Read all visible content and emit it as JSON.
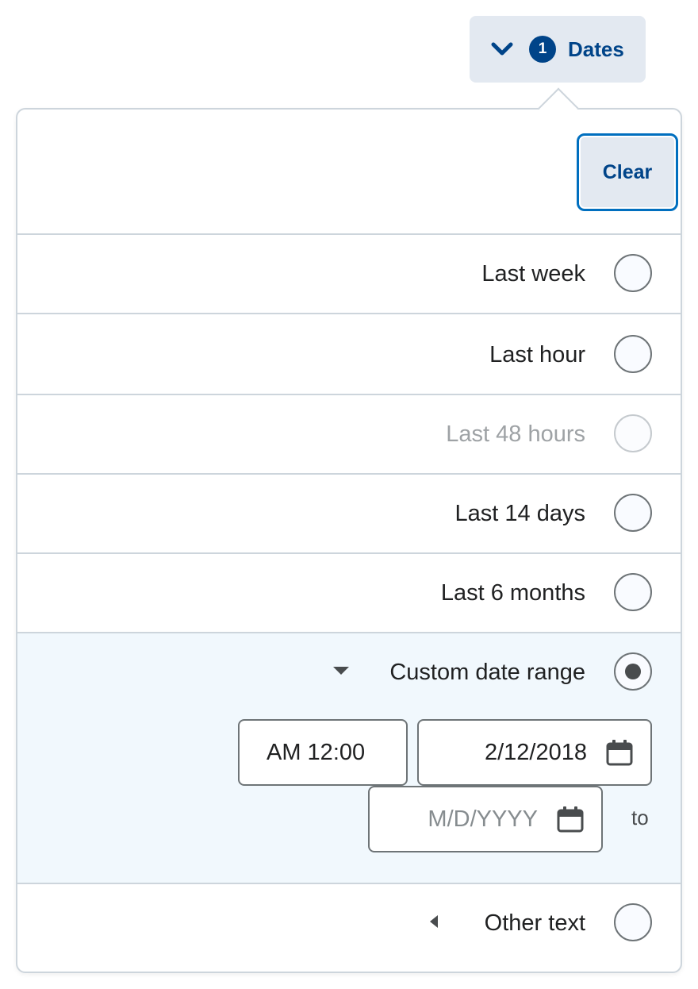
{
  "filter_button": {
    "count": "1",
    "label": "Dates"
  },
  "clear_label": "Clear",
  "options": [
    {
      "label": "Last week",
      "selected": false,
      "disabled": false
    },
    {
      "label": "Last hour",
      "selected": false,
      "disabled": false
    },
    {
      "label": "Last 48 hours",
      "selected": false,
      "disabled": true
    },
    {
      "label": "Last 14 days",
      "selected": false,
      "disabled": false
    },
    {
      "label": "Last 6 months",
      "selected": false,
      "disabled": false
    }
  ],
  "custom_range": {
    "label": "Custom date range",
    "selected": true,
    "expanded": true,
    "start_time": "AM 12:00",
    "start_date": "2/12/2018",
    "end_date_placeholder": "M/D/YYYY",
    "to_label": "to"
  },
  "other": {
    "label": "Other text",
    "selected": false,
    "expanded": false
  },
  "colors": {
    "accent": "#004489",
    "focus_border": "#006fbf",
    "selected_bg": "#f1f8fd",
    "button_bg": "#e3e9f1"
  }
}
